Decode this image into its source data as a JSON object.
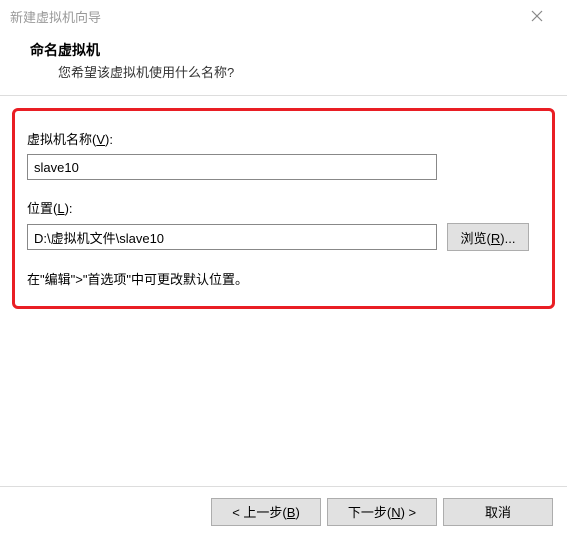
{
  "titlebar": {
    "title": "新建虚拟机向导"
  },
  "header": {
    "title": "命名虚拟机",
    "subtitle": "您希望该虚拟机使用什么名称?"
  },
  "form": {
    "name_label_prefix": "虚拟机名称(",
    "name_label_key": "V",
    "name_label_suffix": "):",
    "name_value": "slave10",
    "location_label_prefix": "位置(",
    "location_label_key": "L",
    "location_label_suffix": "):",
    "location_value": "D:\\虚拟机文件\\slave10",
    "browse_prefix": "浏览(",
    "browse_key": "R",
    "browse_suffix": ")...",
    "hint": "在\"编辑\">\"首选项\"中可更改默认位置。"
  },
  "footer": {
    "back_prefix": "< 上一步(",
    "back_key": "B",
    "back_suffix": ")",
    "next_prefix": "下一步(",
    "next_key": "N",
    "next_suffix": ") >",
    "cancel": "取消"
  }
}
